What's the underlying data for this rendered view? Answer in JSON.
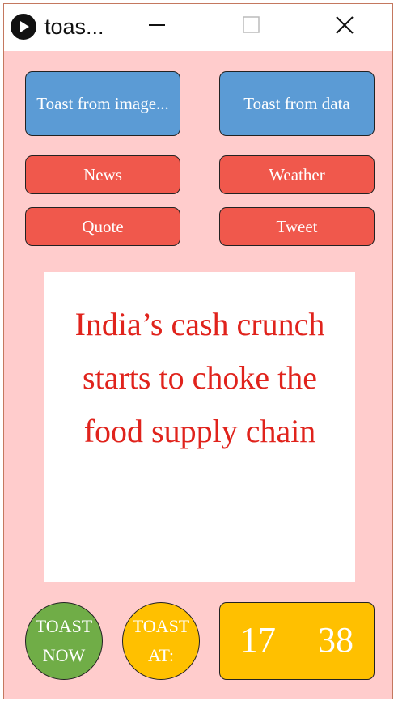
{
  "window": {
    "title": "toas...",
    "icon": "play-icon"
  },
  "titlebar": {
    "minimize_icon": "minimize-icon",
    "maximize_icon": "maximize-icon",
    "close_icon": "close-icon"
  },
  "buttons": {
    "toast_from_image": "Toast from image...",
    "toast_from_data": "Toast from data",
    "news": "News",
    "weather": "Weather",
    "quote": "Quote",
    "tweet": "Tweet"
  },
  "content": {
    "headline": "India’s cash crunch starts to choke the food supply chain"
  },
  "bottom": {
    "toast_now_line1": "TOAST",
    "toast_now_line2": "NOW",
    "toast_at_line1": "TOAST",
    "toast_at_line2": "AT:",
    "hour": "17",
    "minute": "38"
  },
  "colors": {
    "background": "#ffcccc",
    "blue_button": "#5b9bd5",
    "red_button": "#f0584c",
    "headline_text": "#e0231c",
    "green_button": "#70ad47",
    "yellow": "#ffc000"
  }
}
